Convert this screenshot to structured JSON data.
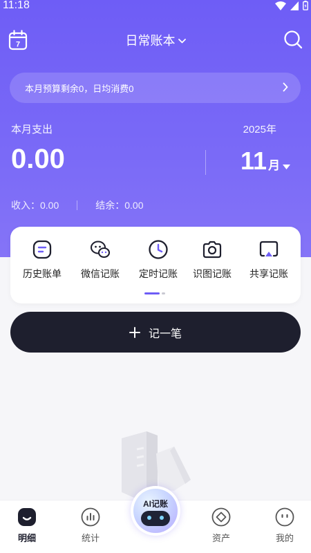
{
  "status_bar": {
    "time": "11:18",
    "icons": [
      "wifi-icon",
      "signal-icon",
      "battery-icon"
    ]
  },
  "header": {
    "calendar_day": "7",
    "book_title": "日常账本",
    "icons": [
      "calendar-icon",
      "chevron-down-icon",
      "search-icon"
    ]
  },
  "budget_bar": {
    "text": "本月预算剩余0，日均消费0"
  },
  "summary": {
    "spend_label": "本月支出",
    "spend_amount": "0.00",
    "year": "2025年",
    "month": "11",
    "month_unit": "月",
    "income": "收入：0.00",
    "balance": "结余：0.00"
  },
  "tools": [
    {
      "label": "历史账单",
      "icon": "history-bill-icon"
    },
    {
      "label": "微信记账",
      "icon": "wechat-icon"
    },
    {
      "label": "定时记账",
      "icon": "clock-icon"
    },
    {
      "label": "识图记账",
      "icon": "camera-icon"
    },
    {
      "label": "共享记账",
      "icon": "share-screen-icon"
    }
  ],
  "add_button": {
    "label": "记一笔"
  },
  "tabbar": {
    "tabs": [
      {
        "label": "明细",
        "icon": "detail-icon",
        "active": true
      },
      {
        "label": "统计",
        "icon": "chart-icon",
        "active": false
      },
      {
        "label": "资产",
        "icon": "asset-icon",
        "active": false
      },
      {
        "label": "我的",
        "icon": "profile-icon",
        "active": false
      }
    ],
    "ai_button": "AI记账"
  },
  "colors": {
    "primary": "#6e5df6",
    "dark": "#1e1f2e",
    "background": "#f6f6f9"
  }
}
